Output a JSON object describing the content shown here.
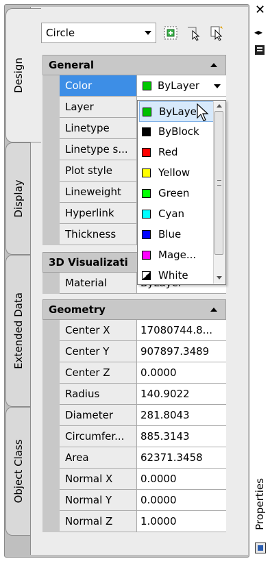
{
  "palette": {
    "object_type": "Circle",
    "title": "Properties"
  },
  "tabs": [
    {
      "label": "Design",
      "active": true
    },
    {
      "label": "Display",
      "active": false
    },
    {
      "label": "Extended Data",
      "active": false
    },
    {
      "label": "Object Class",
      "active": false
    }
  ],
  "toolbar": [
    {
      "icon": "quick-select-icon"
    },
    {
      "icon": "select-objects-icon"
    },
    {
      "icon": "toggle-pickadd-icon"
    }
  ],
  "sections": {
    "general": {
      "title": "General",
      "rows": [
        {
          "name": "Color",
          "value": "ByLayer"
        },
        {
          "name": "Layer",
          "value": ""
        },
        {
          "name": "Linetype",
          "value": ""
        },
        {
          "name": "Linetype s...",
          "value": ""
        },
        {
          "name": "Plot style",
          "value": ""
        },
        {
          "name": "Lineweight",
          "value": ""
        },
        {
          "name": "Hyperlink",
          "value": ""
        },
        {
          "name": "Thickness",
          "value": ""
        }
      ]
    },
    "visualization": {
      "title": "3D Visualizati",
      "rows": [
        {
          "name": "Material",
          "value": "ByLayer"
        }
      ]
    },
    "geometry": {
      "title": "Geometry",
      "rows": [
        {
          "name": "Center X",
          "value": "17080744.8..."
        },
        {
          "name": "Center Y",
          "value": "907897.3489"
        },
        {
          "name": "Center Z",
          "value": "0.0000"
        },
        {
          "name": "Radius",
          "value": "140.9022"
        },
        {
          "name": "Diameter",
          "value": "281.8043"
        },
        {
          "name": "Circumfer...",
          "value": "885.3143"
        },
        {
          "name": "Area",
          "value": "62371.3458"
        },
        {
          "name": "Normal X",
          "value": "0.0000"
        },
        {
          "name": "Normal Y",
          "value": "0.0000"
        },
        {
          "name": "Normal Z",
          "value": "1.0000"
        }
      ]
    }
  },
  "color_dropdown": {
    "selected": "ByLayer",
    "items": [
      {
        "label": "ByLayer",
        "color": "#00c000"
      },
      {
        "label": "ByBlock",
        "color": "#000000"
      },
      {
        "label": "Red",
        "color": "#ff0000"
      },
      {
        "label": "Yellow",
        "color": "#ffff00"
      },
      {
        "label": "Green",
        "color": "#00ff00"
      },
      {
        "label": "Cyan",
        "color": "#00ffff"
      },
      {
        "label": "Blue",
        "color": "#0000ff"
      },
      {
        "label": "Mage...",
        "color": "#ff00ff"
      },
      {
        "label": "White",
        "color": "#ffffff"
      }
    ]
  },
  "colors": {
    "selected_row": "#3d8ee6",
    "dropdown_selection": "#d7e9fb"
  }
}
